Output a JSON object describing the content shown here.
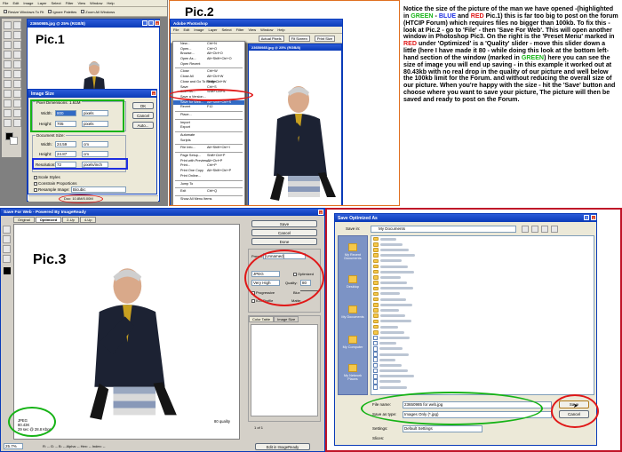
{
  "pic1": {
    "label": "Pic.1",
    "menubar": [
      "File",
      "Edit",
      "Image",
      "Layer",
      "Select",
      "Filter",
      "View",
      "Window",
      "Help"
    ],
    "options": {
      "resize_windows": "Resize Windows To Fit",
      "ignore_palettes": "Ignore Palettes",
      "zoom_all": "Zoom All Windows"
    },
    "doc_title": "23650985.jpg @ 25% (RGB/8)",
    "status_text": "Doc: 10.8M/0.00M",
    "image_size_dialog": {
      "title": "Image Size",
      "pixel_dimensions_label": "Pixel Dimensions: 1.61M",
      "width_label": "Width:",
      "width_value": "800",
      "width_unit": "pixels",
      "height_label": "Height:",
      "height_value": "705",
      "height_unit": "pixels",
      "document_size_label": "Document Size:",
      "doc_width_value": "24.59",
      "doc_width_unit": "cm",
      "doc_height_value": "24.87",
      "doc_height_unit": "cm",
      "resolution_label": "Resolution:",
      "resolution_value": "72",
      "resolution_unit": "pixels/inch",
      "scale_styles": "Scale Styles",
      "constrain": "Constrain Proportions",
      "resample": "Resample Image:",
      "resample_method": "Bicubic",
      "ok": "OK",
      "cancel": "Cancel",
      "auto": "Auto..."
    }
  },
  "pic2": {
    "label": "Pic.2",
    "app_title": "Adobe Photoshop",
    "doc_title": "23650985.jpg @ 25% (RGB/8)",
    "menubar": [
      "File",
      "Edit",
      "Image",
      "Layer",
      "Select",
      "Filter",
      "View",
      "Window",
      "Help"
    ],
    "palette_buttons": [
      "Actual Pixels",
      "Fit Screen",
      "Print Size"
    ],
    "menu_items": [
      {
        "label": "New...",
        "shortcut": "Ctrl+N"
      },
      {
        "label": "Open...",
        "shortcut": "Ctrl+O"
      },
      {
        "label": "Browse...",
        "shortcut": "Alt+Ctrl+O"
      },
      {
        "label": "Open As...",
        "shortcut": "Alt+Shift+Ctrl+O"
      },
      {
        "label": "Open Recent",
        "shortcut": ""
      },
      {
        "sep": true
      },
      {
        "label": "Close",
        "shortcut": "Ctrl+W"
      },
      {
        "label": "Close All",
        "shortcut": "Alt+Ctrl+W"
      },
      {
        "label": "Close and Go To Bridge...",
        "shortcut": "Shift+Ctrl+W"
      },
      {
        "label": "Save",
        "shortcut": "Ctrl+S"
      },
      {
        "label": "Save As...",
        "shortcut": "Shift+Ctrl+S"
      },
      {
        "label": "Save a Version...",
        "shortcut": ""
      },
      {
        "label": "Save for Web...",
        "shortcut": "Alt+Shift+Ctrl+S",
        "highlight": true
      },
      {
        "label": "Revert",
        "shortcut": "F12"
      },
      {
        "sep": true
      },
      {
        "label": "Place...",
        "shortcut": ""
      },
      {
        "sep": true
      },
      {
        "label": "Import",
        "shortcut": ""
      },
      {
        "label": "Export",
        "shortcut": ""
      },
      {
        "sep": true
      },
      {
        "label": "Automate",
        "shortcut": ""
      },
      {
        "label": "Scripts",
        "shortcut": ""
      },
      {
        "sep": true
      },
      {
        "label": "File Info...",
        "shortcut": "Alt+Shift+Ctrl+I"
      },
      {
        "sep": true
      },
      {
        "label": "Page Setup...",
        "shortcut": "Shift+Ctrl+P"
      },
      {
        "label": "Print with Preview...",
        "shortcut": "Alt+Ctrl+P"
      },
      {
        "label": "Print...",
        "shortcut": "Ctrl+P"
      },
      {
        "label": "Print One Copy",
        "shortcut": "Alt+Shift+Ctrl+P"
      },
      {
        "label": "Print Online...",
        "shortcut": ""
      },
      {
        "sep": true
      },
      {
        "label": "Jump To",
        "shortcut": ""
      },
      {
        "sep": true
      },
      {
        "label": "Exit",
        "shortcut": "Ctrl+Q"
      },
      {
        "sep": true
      },
      {
        "label": "Show All Menu Items",
        "shortcut": ""
      }
    ]
  },
  "pic3": {
    "label": "Pic.3",
    "title": "Save For Web - Powered By ImageReady",
    "tabs": [
      "Original",
      "Optimized",
      "2-Up",
      "4-Up"
    ],
    "buttons": {
      "save": "Save",
      "cancel": "Cancel",
      "done": "Done",
      "edit_imageready": "Edit in ImageReady"
    },
    "preset_label": "Preset:",
    "preset_value": "[Unnamed]",
    "format": "JPEG",
    "quality_level": "Very High",
    "quality_label": "Quality:",
    "quality_value": "80",
    "blur_label": "Blur:",
    "matte_label": "Matte:",
    "optimized": "Optimized",
    "progressive": "Progressive",
    "icc": "ICC Profile",
    "color_table_tab": "Color Table",
    "image_size_tab": "Image Size",
    "info_lines": [
      "JPEG",
      "80.43K",
      "29 sec @ 28.8 Kbps"
    ],
    "quality_readout": "80 quality",
    "zoom": "25.7%",
    "bottom_status": "R: --  G: --  B: --  Alpha: --  Hex: --  Index: --",
    "pager": "1 of 1"
  },
  "save_dialog": {
    "title": "Save Optimized As",
    "save_in_label": "Save in:",
    "save_in_value": "My Documents",
    "places": [
      "My Recent Documents",
      "Desktop",
      "My Documents",
      "My Computer",
      "My Network Places"
    ],
    "filename_label": "File name:",
    "filename_value": "23650985 for web.jpg",
    "type_label": "Save as type:",
    "type_value": "Images Only (*.jpg)",
    "settings_label": "Settings:",
    "settings_value": "Default Settings",
    "slices_label": "Slices:",
    "save": "Save",
    "cancel": "Cancel"
  },
  "description": {
    "p1": "Notice the size of the picture of the man we have opened -(highlighted in ",
    "green1": "GREEN",
    "p2": " - ",
    "blue1": "BLUE",
    "p3": " and ",
    "red1": "RED",
    "p4": " Pic.1) this is far too big to post on the forum (HTCIP Forum) which requires files no bigger than 100kb. To fix this - look at Pic.2 - go to 'File' - then 'Save For Web'. This will open another window in Photoshop Pic3. On the right is the 'Preset Menu' marked in ",
    "red2": "RED",
    "p5": " under 'Optimized' is a 'Quality' slider - move this slider down a little (here I have made it 80 - while doing this look at the bottom left-hand section of the window (marked in ",
    "green2": "GREEN",
    "p6": ") here you can see the size of image you will end up saving - in this example it worked out at 80.43kb with no real drop in the quality of our picture and  well below the 100kb limit for the Forum. and without reducing the overall size of our  picture. When you're happy with the size - hit the 'Save' button and choose where you want to save your picture, The picture will then be saved and ready to post on the Forum."
  },
  "colors": {
    "green": "#16b316",
    "blue": "#1f2fe0",
    "red": "#e01818",
    "xp_title": "#0a3bb8"
  }
}
